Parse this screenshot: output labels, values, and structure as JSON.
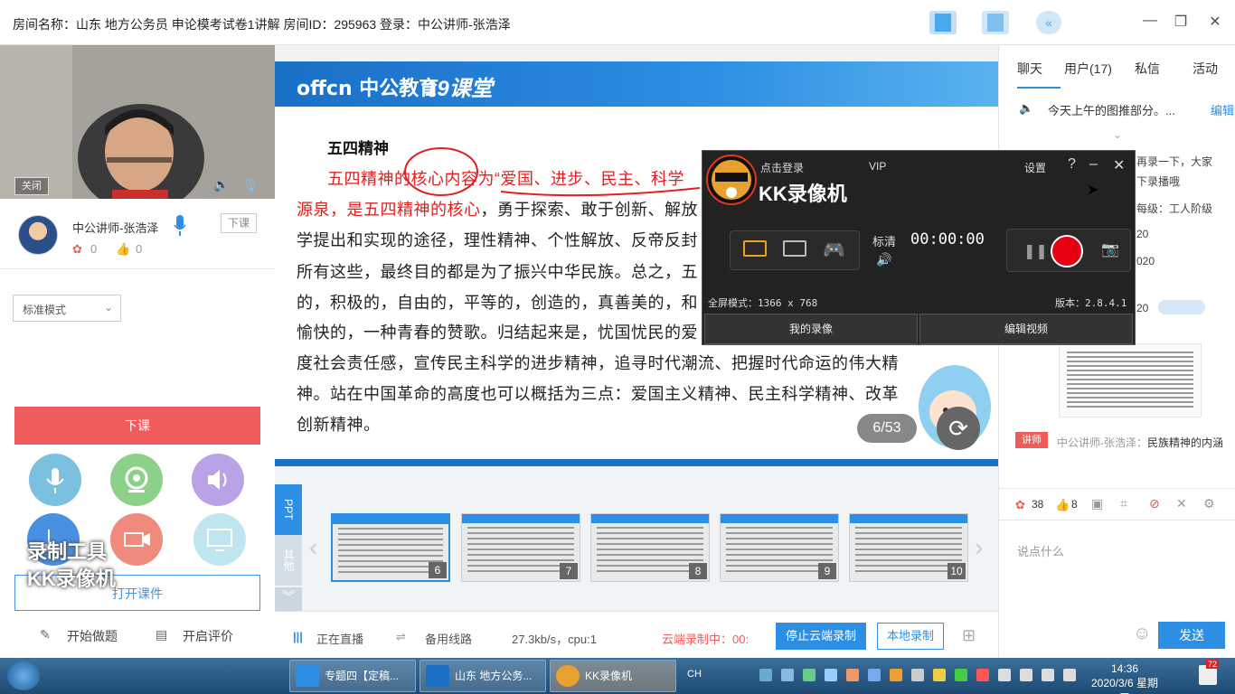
{
  "window": {
    "title": "房间名称：山东 地方公务员 申论模考试卷1讲解 房间ID：295963 登录：中公讲师-张浩泽"
  },
  "left": {
    "cam_chip": "关闭",
    "teacher_name": "中公讲师-张浩泽",
    "end_small": "下课",
    "flowers": "0",
    "likes": "0",
    "mode": "标准模式",
    "end_class": "下课",
    "open_course": "打开课件",
    "start_quiz": "开始做题",
    "start_eval": "开启评价"
  },
  "slide": {
    "brand": "offcn 中公教育",
    "brand2": "19课堂",
    "heading": "五四精神",
    "line1_red": "五四精神的核心内容为“爱国、进步、民主、科学",
    "line2_red": "源泉，是五四精神的核心",
    "line2_black": "，勇于探索、敢于创新、解放",
    "line3": "学提出和实现的途径，理性精神、个性解放、反帝反封",
    "line4": "所有这些，最终目的都是为了振兴中华民族。总之，五",
    "line5": "的，积极的，自由的，平等的，创造的，真善美的，和",
    "line6": "愉快的，一种青春的赞歌。归结起来是，忧国忧民的爱",
    "line7": "度社会责任感，宣传民主科学的进步精神，追寻时代潮流、把握时代命运的伟大精",
    "line8": "神。站在中国革命的高度也可以概括为三点：爱国主义精神、民主科学精神、改革",
    "line9": "创新精神。",
    "page": "6/53"
  },
  "thumbs": {
    "tab_ppt": "PPT",
    "tab_other": "其他",
    "items": [
      {
        "num": "6"
      },
      {
        "num": "7"
      },
      {
        "num": "8"
      },
      {
        "num": "9"
      },
      {
        "num": "10"
      }
    ]
  },
  "status": {
    "live": "正在直播",
    "backup": "备用线路",
    "speed": "27.3kb/s，cpu:1",
    "cloud": "云端录制中：00:",
    "stop_cloud": "停止云端录制",
    "local_rec": "本地录制"
  },
  "right": {
    "tabs": [
      "聊天",
      "用户(17)",
      "私信",
      "活动"
    ],
    "notice": "今天上午的图推部分。...",
    "notice_edit": "编辑",
    "chat": [
      "再录一下，大家",
      "下录播哦",
      "每级：工人阶级",
      "20",
      "020",
      "20"
    ],
    "lecturer_badge": "讲师",
    "lecturer_name": "中公讲师-张浩泽：",
    "lecturer_msg": "民族精神的内涵",
    "flowers": "38",
    "likes": "8",
    "say": "说点什么",
    "send": "发送"
  },
  "kk": {
    "login": "点击登录",
    "vip": "VIP",
    "title": "KK录像机",
    "settings": "设置",
    "quality": "标清",
    "time": "00:00:00",
    "fullscreen": "全屏模式：1366 x 768",
    "version": "版本：2.8.4.1",
    "my_rec": "我的录像",
    "edit_video": "编辑视频"
  },
  "watermark": {
    "line1": "录制工具",
    "line2": "KK录像机"
  },
  "taskbar": {
    "tasks": [
      "专题四【定稿...",
      "山东 地方公务...",
      "KK录像机"
    ],
    "ime": "CH",
    "time": "14:36",
    "date": "2020/3/6 星期五",
    "notif": "72"
  },
  "colors": {
    "accent": "#2c8fe4",
    "danger": "#f05c5c",
    "rec_red": "#e60012"
  }
}
